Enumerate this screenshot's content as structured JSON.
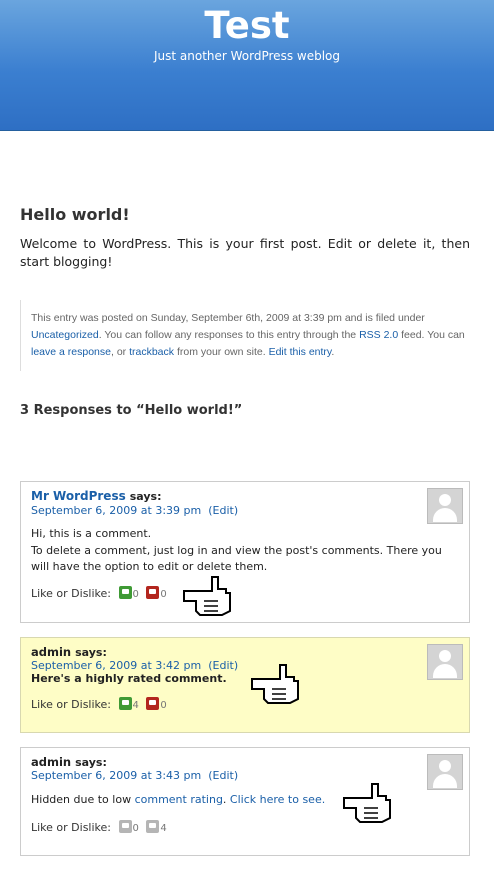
{
  "site": {
    "title": "Test",
    "description": "Just another WordPress weblog"
  },
  "post": {
    "title": "Hello world!",
    "body": "Welcome to WordPress. This is your first post. Edit or delete it, then start blogging!",
    "meta": {
      "p1": "This entry was posted on Sunday, September 6th, 2009 at 3:39 pm and is filed under",
      "category": "Uncategorized",
      "p2": ". You can follow any responses to this entry through the",
      "rss": "RSS 2.0",
      "p3": "feed.",
      "p4": "You can",
      "leave": "leave a response",
      "p5": ", or",
      "trackback": "trackback",
      "p6": "from your own site.",
      "edit": "Edit this entry",
      "p7": "."
    }
  },
  "responses_title": "3 Responses to “Hello world!”",
  "comments": [
    {
      "author": "Mr WordPress",
      "says": "says:",
      "date": "September 6, 2009 at 3:39 pm",
      "edit": "(Edit)",
      "line1": "Hi, this is a comment.",
      "line2": "To delete a comment, just log in and view the post's comments. There you will have the option to edit or delete them.",
      "like_label": "Like or Dislike:",
      "likes": "0",
      "dislikes": "0"
    },
    {
      "author": "admin",
      "says": "says:",
      "date": "September 6, 2009 at 3:42 pm",
      "edit": "(Edit)",
      "text": "Here's a highly rated comment.",
      "like_label": "Like or Dislike:",
      "likes": "4",
      "dislikes": "0"
    },
    {
      "author": "admin",
      "says": "says:",
      "date": "September 6, 2009 at 3:43 pm",
      "edit": "(Edit)",
      "hidden_text": "Hidden due to low",
      "rating_link": "comment rating",
      "dot": ".",
      "click_link": "Click here to see.",
      "like_label": "Like or Dislike:",
      "likes": "0",
      "dislikes": "4"
    }
  ],
  "colors": {
    "header": "#3b7fd0",
    "link": "#1a5fa8",
    "highlight": "#fefdc6",
    "like": "#3f9a35",
    "dislike": "#b3261e"
  },
  "icons": [
    "thumbs-up-icon",
    "thumbs-down-icon",
    "avatar-icon",
    "hand-pointer-icon"
  ]
}
